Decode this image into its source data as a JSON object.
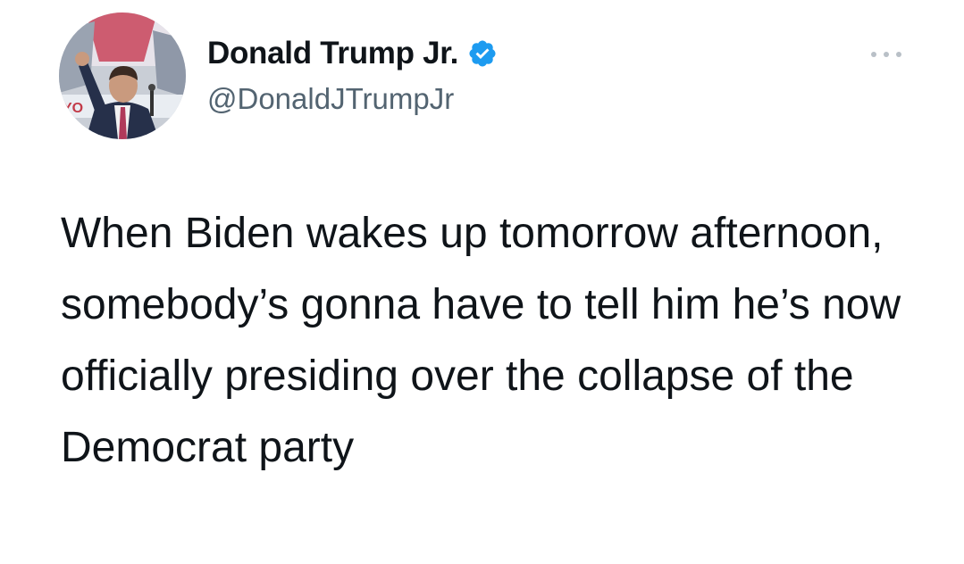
{
  "tweet": {
    "author": {
      "display_name": "Donald Trump Jr.",
      "handle": "@DonaldJTrumpJr",
      "verified": true
    },
    "text": "When Biden wakes up tomorrow afternoon, somebody’s gonna have to tell him he’s now officially presiding over the collapse of the Democrat party"
  },
  "avatar": {
    "backdrop_text": "YO"
  },
  "icons": {
    "verified": "verified-badge-icon",
    "more": "more-options-icon"
  },
  "colors": {
    "text_primary": "#0f1419",
    "text_secondary": "#536471",
    "verified_blue": "#1d9bf0",
    "more_dots": "#b9c0c7"
  }
}
